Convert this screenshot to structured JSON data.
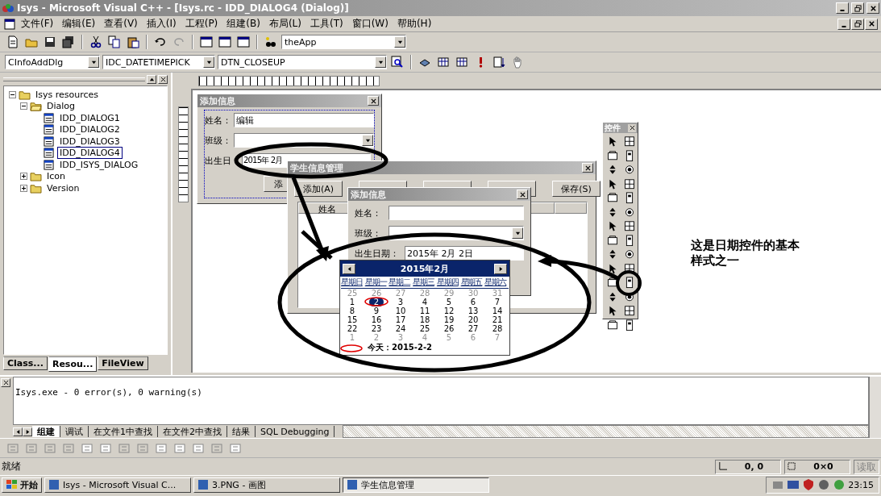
{
  "window": {
    "title": "Isys - Microsoft Visual C++ - [Isys.rc - IDD_DIALOG4 (Dialog)]"
  },
  "menu": [
    "文件(F)",
    "编辑(E)",
    "查看(V)",
    "插入(I)",
    "工程(P)",
    "组建(B)",
    "布局(L)",
    "工具(T)",
    "窗口(W)",
    "帮助(H)"
  ],
  "toolbar": {
    "combo": "theApp"
  },
  "wizard_bar": {
    "class": "CInfoAddDlg",
    "control": "IDC_DATETIMEPICK",
    "message": "DTN_CLOSEUP"
  },
  "workspace": {
    "tree": [
      {
        "label": "Isys resources",
        "expanded": true,
        "children": [
          {
            "label": "Dialog",
            "expanded": true,
            "children": [
              {
                "label": "IDD_DIALOG1",
                "selected": false
              },
              {
                "label": "IDD_DIALOG2",
                "selected": false
              },
              {
                "label": "IDD_DIALOG3",
                "selected": false
              },
              {
                "label": "IDD_DIALOG4",
                "selected": true
              },
              {
                "label": "IDD_ISYS_DIALOG",
                "selected": false
              }
            ]
          },
          {
            "label": "Icon",
            "expanded": false
          },
          {
            "label": "Version",
            "expanded": false
          }
        ]
      }
    ],
    "tabs": [
      {
        "label": "Class...",
        "selected": false
      },
      {
        "label": "Resou...",
        "selected": true
      },
      {
        "label": "FileView",
        "selected": false
      }
    ]
  },
  "design_dialog": {
    "title": "添加信息",
    "name_label": "姓名：",
    "name_value": "编辑",
    "class_label": "班级：",
    "date_label": "出生日",
    "date_value": "2015年 2月",
    "button": "添"
  },
  "main_window": {
    "title": "学生信息管理",
    "buttons": [
      {
        "kind": "label",
        "label": "添加(A)"
      },
      {
        "kind": "covered"
      },
      {
        "kind": "covered"
      },
      {
        "kind": "covered"
      },
      {
        "kind": "label",
        "label": "保存(S)"
      }
    ],
    "list_header": "姓名"
  },
  "add_dialog": {
    "title": "添加信息",
    "name_label": "姓名：",
    "class_label": "班级：",
    "date_label": "出生日期：",
    "date_value": "2015年 2月 2日"
  },
  "calendar": {
    "month": "2015年2月",
    "weekdays": [
      "星期日",
      "星期一",
      "星期二",
      "星期三",
      "星期四",
      "星期五",
      "星期六"
    ],
    "days": [
      {
        "day": "25",
        "kind": "other",
        "selected": false
      },
      {
        "day": "26",
        "kind": "other",
        "selected": false
      },
      {
        "day": "27",
        "kind": "other",
        "selected": false
      },
      {
        "day": "28",
        "kind": "other",
        "selected": false
      },
      {
        "day": "29",
        "kind": "other",
        "selected": false
      },
      {
        "day": "30",
        "kind": "other",
        "selected": false
      },
      {
        "day": "31",
        "kind": "other",
        "selected": false
      },
      {
        "day": "1",
        "kind": "month",
        "selected": false
      },
      {
        "day": "2",
        "kind": "month",
        "selected": true
      },
      {
        "day": "3",
        "kind": "month",
        "selected": false
      },
      {
        "day": "4",
        "kind": "month",
        "selected": false
      },
      {
        "day": "5",
        "kind": "month",
        "selected": false
      },
      {
        "day": "6",
        "kind": "month",
        "selected": false
      },
      {
        "day": "7",
        "kind": "month",
        "selected": false
      },
      {
        "day": "8",
        "kind": "month",
        "selected": false
      },
      {
        "day": "9",
        "kind": "month",
        "selected": false
      },
      {
        "day": "10",
        "kind": "month",
        "selected": false
      },
      {
        "day": "11",
        "kind": "month",
        "selected": false
      },
      {
        "day": "12",
        "kind": "month",
        "selected": false
      },
      {
        "day": "13",
        "kind": "month",
        "selected": false
      },
      {
        "day": "14",
        "kind": "month",
        "selected": false
      },
      {
        "day": "15",
        "kind": "month",
        "selected": false
      },
      {
        "day": "16",
        "kind": "month",
        "selected": false
      },
      {
        "day": "17",
        "kind": "month",
        "selected": false
      },
      {
        "day": "18",
        "kind": "month",
        "selected": false
      },
      {
        "day": "19",
        "kind": "month",
        "selected": false
      },
      {
        "day": "20",
        "kind": "month",
        "selected": false
      },
      {
        "day": "21",
        "kind": "month",
        "selected": false
      },
      {
        "day": "22",
        "kind": "month",
        "selected": false
      },
      {
        "day": "23",
        "kind": "month",
        "selected": false
      },
      {
        "day": "24",
        "kind": "month",
        "selected": false
      },
      {
        "day": "25",
        "kind": "month",
        "selected": false
      },
      {
        "day": "26",
        "kind": "month",
        "selected": false
      },
      {
        "day": "27",
        "kind": "month",
        "selected": false
      },
      {
        "day": "28",
        "kind": "month",
        "selected": false
      },
      {
        "day": "1",
        "kind": "other",
        "selected": false
      },
      {
        "day": "2",
        "kind": "other",
        "selected": false
      },
      {
        "day": "3",
        "kind": "other",
        "selected": false
      },
      {
        "day": "4",
        "kind": "other",
        "selected": false
      },
      {
        "day": "5",
        "kind": "other",
        "selected": false
      },
      {
        "day": "6",
        "kind": "other",
        "selected": false
      },
      {
        "day": "7",
        "kind": "other",
        "selected": false
      }
    ],
    "today": "今天：2015-2-2"
  },
  "toolbox": {
    "title": "控件"
  },
  "note": "这是日期控件的基本样式之一",
  "output": {
    "lines": [
      "Isys.exe - 0 error(s), 0 warning(s)"
    ],
    "tabs": [
      {
        "label": "组建",
        "selected": true
      },
      {
        "label": "调试",
        "selected": false
      },
      {
        "label": "在文件1中查找",
        "selected": false
      },
      {
        "label": "在文件2中查找",
        "selected": false
      },
      {
        "label": "结果",
        "selected": false
      },
      {
        "label": "SQL Debugging",
        "selected": false
      }
    ]
  },
  "status_bar": {
    "text": "就绪",
    "position": "0, 0",
    "size": "0×0",
    "mode": {
      "label": "读取",
      "disabled": true
    }
  },
  "taskbar": {
    "start": "开始",
    "tasks": [
      {
        "label": "Isys - Microsoft Visual C...",
        "selected": false
      },
      {
        "label": "3.PNG - 画图",
        "selected": false
      },
      {
        "label": "学生信息管理",
        "selected": true
      }
    ],
    "clock": "23:15"
  }
}
